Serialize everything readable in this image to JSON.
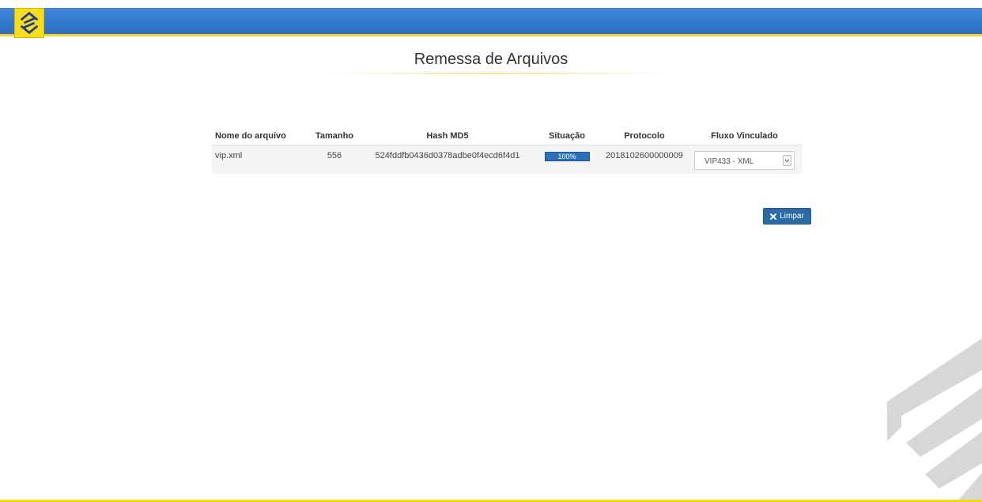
{
  "header": {
    "logo_icon": "bb-logo-icon",
    "bar_color": "#2f74cc",
    "accent_color": "#f4d51a"
  },
  "page": {
    "title": "Remessa de Arquivos"
  },
  "table": {
    "columns": [
      "Nome do arquivo",
      "Tamanho",
      "Hash MD5",
      "Situação",
      "Protocolo",
      "Fluxo Vinculado"
    ],
    "rows": [
      {
        "name": "vip.xml",
        "size": "556",
        "hash": "524fddfb0436d0378adbe0f4ecd6f4d1",
        "status_label": "100%",
        "status_progress": 100,
        "protocol": "2018102600000009",
        "flow": "VIP433 - XML"
      }
    ]
  },
  "actions": {
    "clear_label": "Limpar",
    "clear_icon": "times-icon",
    "button_color": "#2c6aa6"
  }
}
